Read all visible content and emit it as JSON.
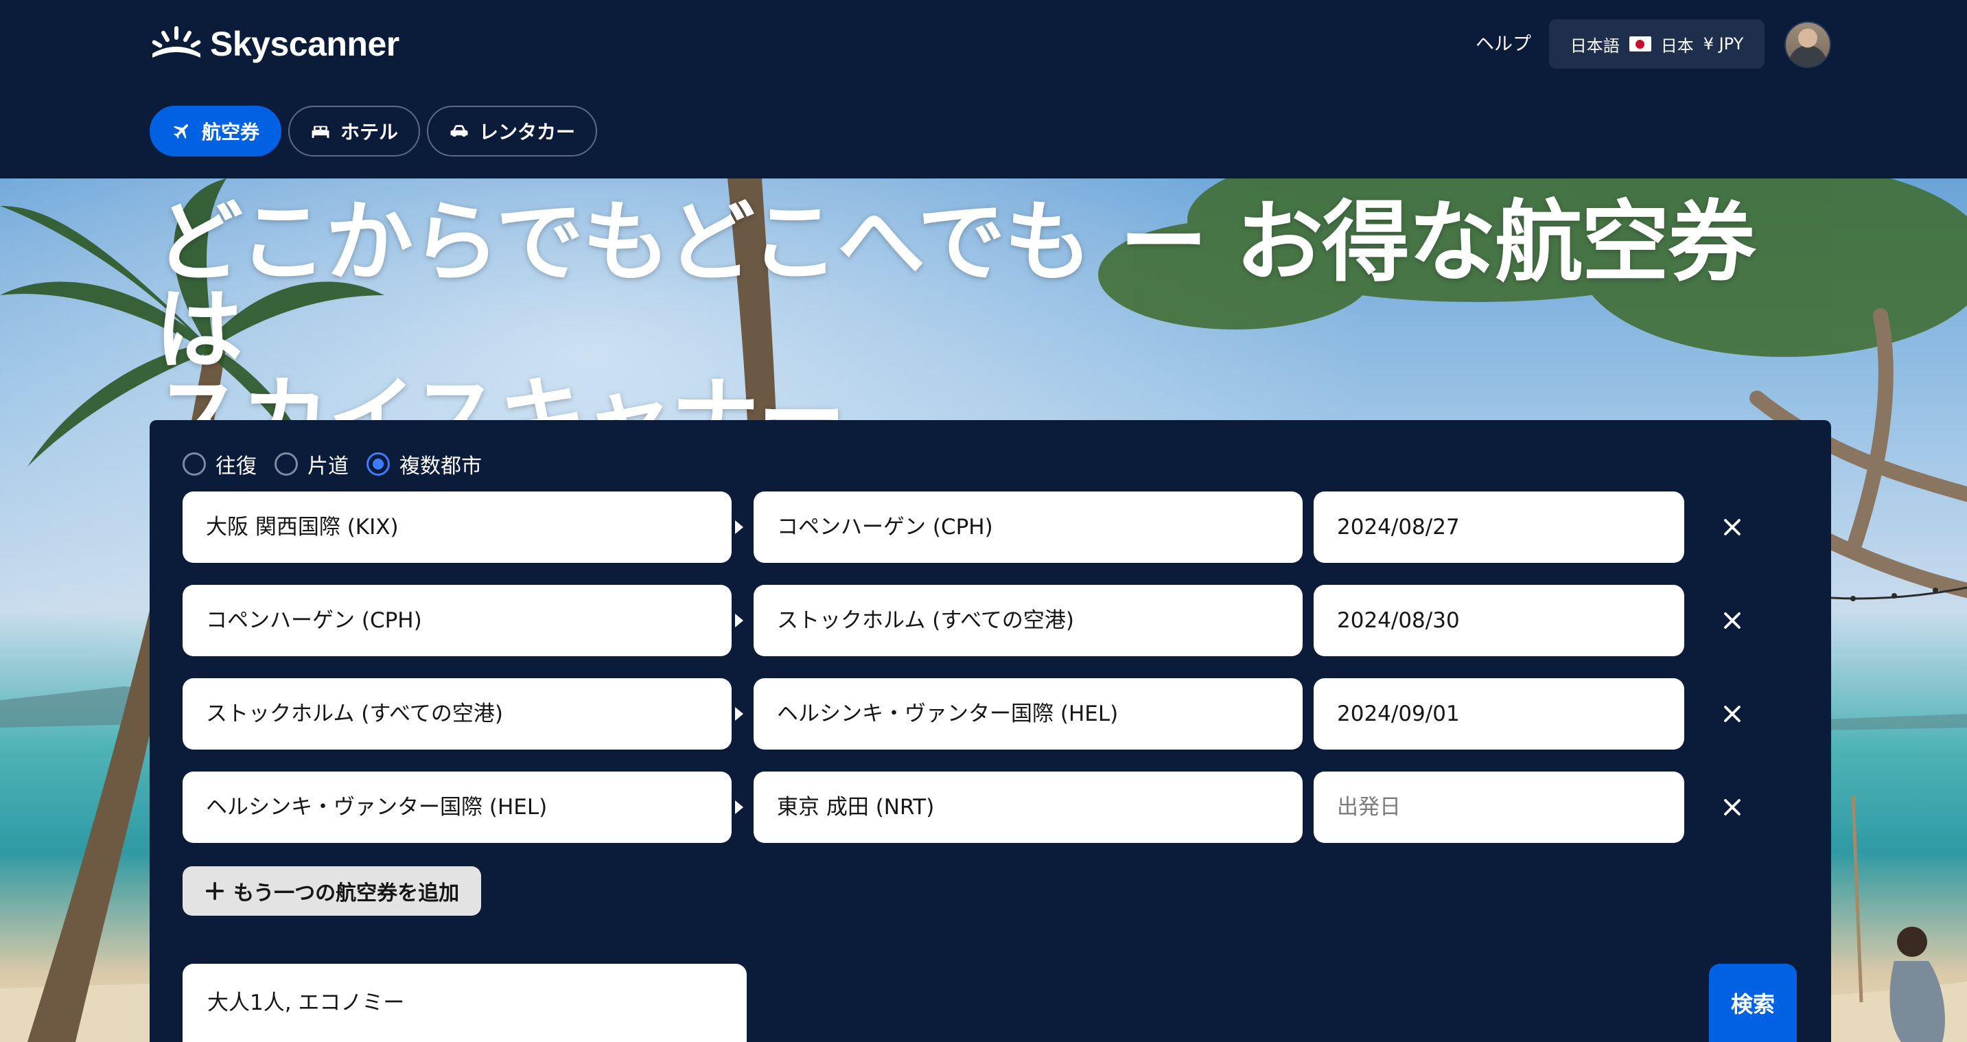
{
  "brand": {
    "name": "Skyscanner"
  },
  "header": {
    "help_label": "ヘルプ",
    "locale": {
      "language": "日本語",
      "country": "日本",
      "currency": "¥ JPY"
    }
  },
  "tabs": [
    {
      "label": "航空券",
      "icon": "airplane-icon",
      "active": true
    },
    {
      "label": "ホテル",
      "icon": "bed-icon",
      "active": false
    },
    {
      "label": "レンタカー",
      "icon": "car-icon",
      "active": false
    }
  ],
  "hero": {
    "headline_line1": "どこからでもどこへでも ー お得な航空券は",
    "headline_line2": "スカイスキャナー"
  },
  "search": {
    "trip_types": [
      {
        "label": "往復",
        "checked": false
      },
      {
        "label": "片道",
        "checked": false
      },
      {
        "label": "複数都市",
        "checked": true
      }
    ],
    "legs": [
      {
        "from": "大阪 関西国際 (KIX)",
        "to": "コペンハーゲン (CPH)",
        "date": "2024/08/27"
      },
      {
        "from": "コペンハーゲン (CPH)",
        "to": "ストックホルム (すべての空港)",
        "date": "2024/08/30"
      },
      {
        "from": "ストックホルム (すべての空港)",
        "to": "ヘルシンキ・ヴァンター国際 (HEL)",
        "date": "2024/09/01"
      },
      {
        "from": "ヘルシンキ・ヴァンター国際 (HEL)",
        "to": "東京 成田 (NRT)",
        "date": "",
        "date_placeholder": "出発日"
      }
    ],
    "add_leg_label": "もう一つの航空券を追加",
    "travellers_label": "大人1人, エコノミー",
    "search_label": "検索"
  },
  "colors": {
    "header_bg": "#0b1b3a",
    "accent": "#0062e3",
    "radio_checked": "#3d7bff"
  }
}
